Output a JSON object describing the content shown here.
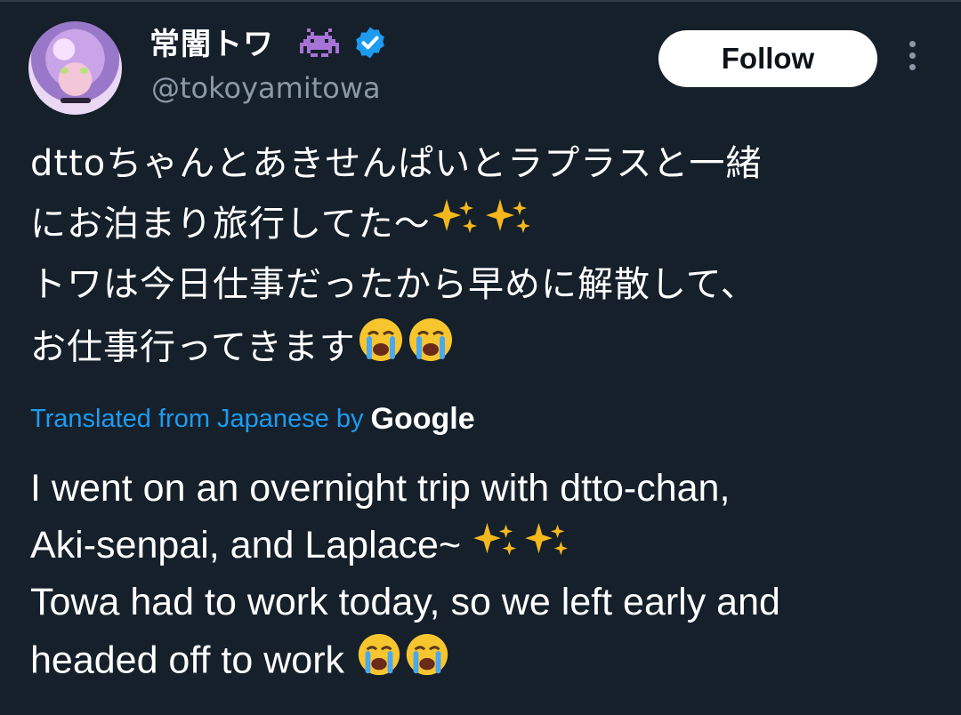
{
  "author": {
    "display_name": "常闇トワ",
    "handle": "@tokoyamitowa",
    "icons": [
      "space-invader-icon",
      "verified-badge-icon"
    ]
  },
  "actions": {
    "follow_label": "Follow",
    "more_icon": "more-vertical-icon"
  },
  "tweet": {
    "original_lines": [
      "dttoちゃんとあきせんぱいとラプラスと一緒",
      "にお泊まり旅行してた〜",
      "トワは今日仕事だったから早めに解散して、",
      "お仕事行ってきます"
    ],
    "translation_label": "Translated from Japanese by",
    "translation_provider": "Google",
    "translated_lines": [
      "I went on an overnight trip with dtto-chan,",
      "Aki-senpai, and Laplace~",
      "Towa had to work today, so we left early and",
      "headed off to work"
    ],
    "emojis": [
      "sparkles",
      "sparkles",
      "crying-face",
      "crying-face"
    ]
  },
  "colors": {
    "background": "#15202b",
    "text": "#ffffff",
    "secondary_text": "#8b98a5",
    "link": "#1d9bf0",
    "verified": "#1d9bf0",
    "invader": "#a873d6"
  }
}
